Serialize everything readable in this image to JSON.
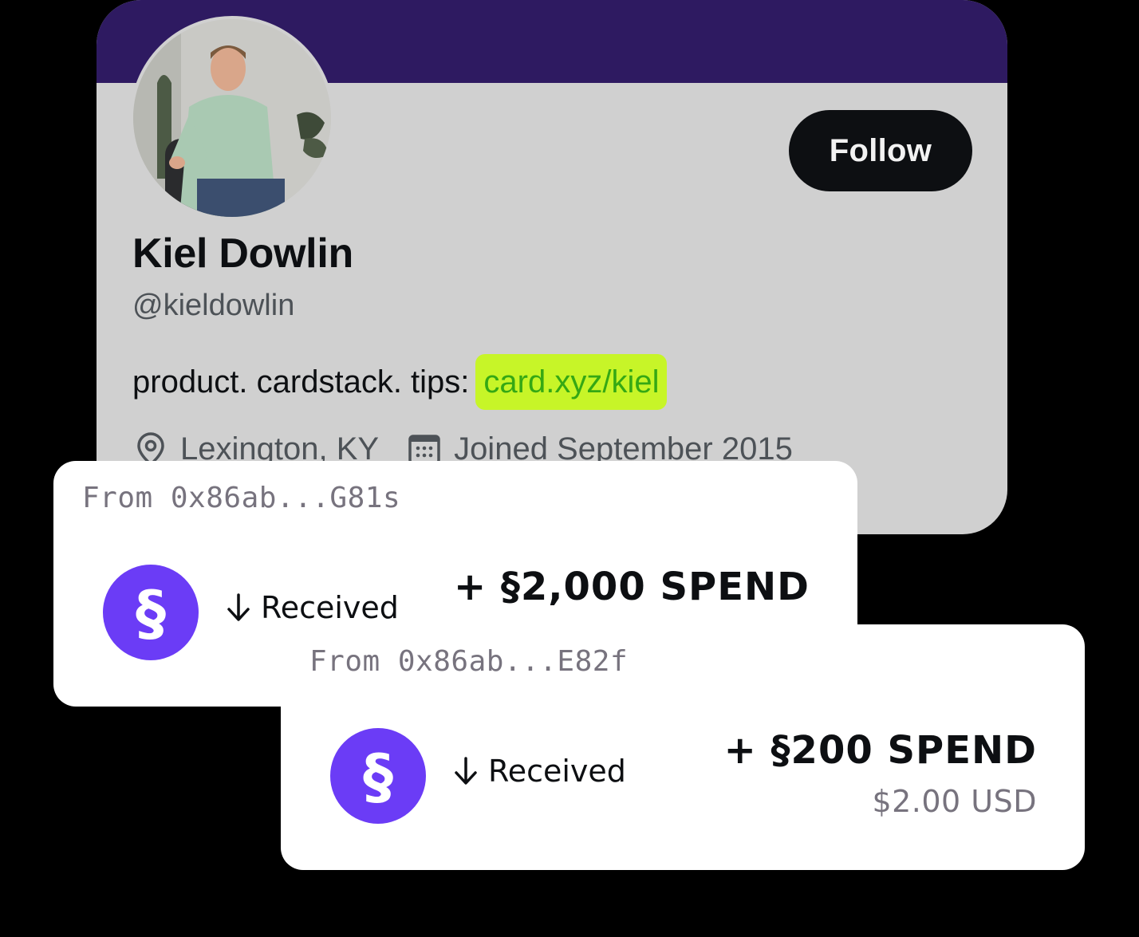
{
  "profile": {
    "name": "Kiel Dowlin",
    "handle": "@kieldowlin",
    "bio_text": "product. cardstack. tips:",
    "bio_link": "card.xyz/kiel",
    "location": "Lexington, KY",
    "joined": "Joined September 2015",
    "follow_label": "Follow",
    "banner_color": "#2e1a61",
    "link_highlight_color": "#c7f528"
  },
  "transactions": [
    {
      "from": "From 0x86ab...G81s",
      "status": "Received",
      "amount": "+ §2,000 SPEND",
      "coin_symbol": "§"
    },
    {
      "from": "From 0x86ab...E82f",
      "status": "Received",
      "amount": "+ §200 SPEND",
      "usd": "$2.00 USD",
      "coin_symbol": "§"
    }
  ],
  "colors": {
    "coin": "#6b3cf6"
  }
}
